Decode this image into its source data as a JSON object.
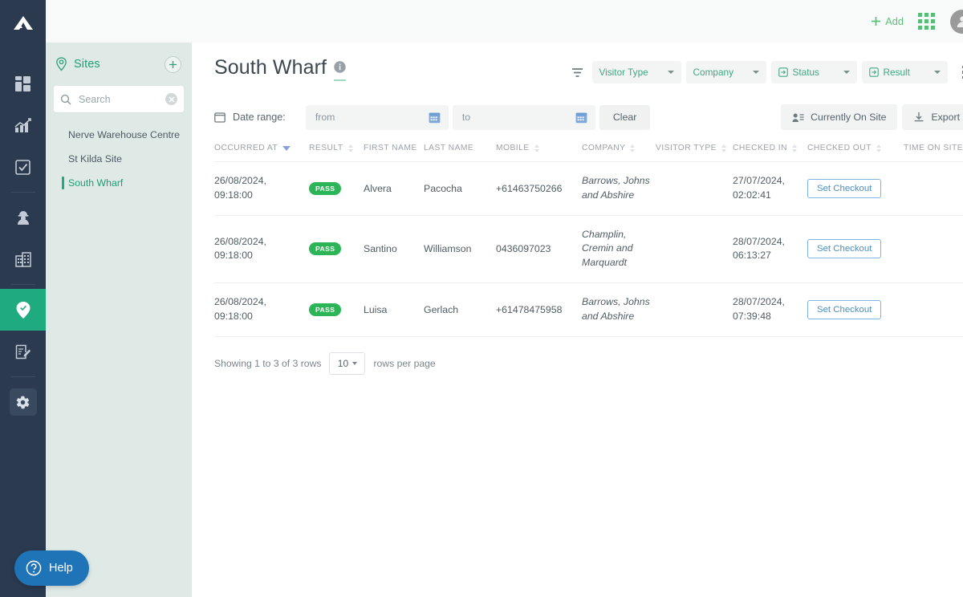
{
  "topbar": {
    "add_label": "Add",
    "add_icon": "plus-icon",
    "apps_icon": "apps-grid-icon",
    "avatar_icon": "user-avatar-icon"
  },
  "rail": {
    "logo_icon": "mountain-logo-icon",
    "items": [
      {
        "icon": "dashboard-grid-icon",
        "name": "dashboard",
        "active": false
      },
      {
        "icon": "bar-chart-icon",
        "name": "analytics",
        "active": false
      },
      {
        "icon": "checklist-icon",
        "name": "tasks",
        "active": false
      },
      {
        "icon": "worker-icon",
        "name": "workers",
        "active": false
      },
      {
        "icon": "building-icon",
        "name": "companies",
        "active": false
      },
      {
        "icon": "location-pin-check-icon",
        "name": "sites",
        "active": true
      },
      {
        "icon": "clipboard-edit-icon",
        "name": "forms",
        "active": false
      },
      {
        "icon": "gear-icon",
        "name": "settings",
        "active": false
      }
    ]
  },
  "sites_panel": {
    "pin_icon": "location-pin-icon",
    "title": "Sites",
    "add_icon": "plus-icon",
    "search": {
      "icon": "search-icon",
      "value": "",
      "placeholder": "Search",
      "clear_icon": "clear-circle-icon"
    },
    "items": [
      {
        "label": "Nerve Warehouse Centre",
        "active": false
      },
      {
        "label": "St Kilda Site",
        "active": false
      },
      {
        "label": "South Wharf",
        "active": true
      }
    ]
  },
  "page": {
    "title": "South Wharf",
    "info_icon": "info-icon"
  },
  "filters": {
    "funnel_icon": "filter-funnel-icon",
    "pills": [
      {
        "label": "Visitor Type",
        "icon": null
      },
      {
        "label": "Company",
        "icon": null
      },
      {
        "label": "Status",
        "icon": "login-box-icon"
      },
      {
        "label": "Result",
        "icon": "login-box-icon"
      }
    ],
    "kebab_icon": "more-vertical-icon"
  },
  "daterange": {
    "calendar_icon": "calendar-outline-icon",
    "label": "Date range:",
    "from": {
      "value": "",
      "placeholder": "from",
      "icon": "calendar-icon"
    },
    "to": {
      "value": "",
      "placeholder": "to",
      "icon": "calendar-icon"
    },
    "clear_label": "Clear"
  },
  "actions": {
    "currently_on_site": {
      "label": "Currently On Site",
      "icon": "people-list-icon"
    },
    "export": {
      "label": "Export",
      "icon": "download-icon"
    }
  },
  "table": {
    "columns": [
      {
        "label": "Occurred At",
        "sort": "desc"
      },
      {
        "label": "Result",
        "sort": "both"
      },
      {
        "label": "First Name",
        "sort": "none"
      },
      {
        "label": "Last Name",
        "sort": "none"
      },
      {
        "label": "Mobile",
        "sort": "both"
      },
      {
        "label": "Company",
        "sort": "both"
      },
      {
        "label": "Visitor Type",
        "sort": "both"
      },
      {
        "label": "Checked In",
        "sort": "both"
      },
      {
        "label": "Checked Out",
        "sort": "both"
      },
      {
        "label": "Time On Site",
        "sort": "none"
      }
    ],
    "rows": [
      {
        "occurred_at": "26/08/2024, 09:18:00",
        "result": "PASS",
        "first_name": "Alvera",
        "last_name": "Pacocha",
        "mobile": "+61463750266",
        "company": "Barrows, Johns and Abshire",
        "visitor_type": "",
        "checked_in": "27/07/2024, 02:02:41",
        "checked_out_action": "Set Checkout",
        "time_on_site": ""
      },
      {
        "occurred_at": "26/08/2024, 09:18:00",
        "result": "PASS",
        "first_name": "Santino",
        "last_name": "Williamson",
        "mobile": "0436097023",
        "company": "Champlin, Cremin and Marquardt",
        "visitor_type": "",
        "checked_in": "28/07/2024, 06:13:27",
        "checked_out_action": "Set Checkout",
        "time_on_site": ""
      },
      {
        "occurred_at": "26/08/2024, 09:18:00",
        "result": "PASS",
        "first_name": "Luisa",
        "last_name": "Gerlach",
        "mobile": "+61478475958",
        "company": "Barrows, Johns and Abshire",
        "visitor_type": "",
        "checked_in": "28/07/2024, 07:39:48",
        "checked_out_action": "Set Checkout",
        "time_on_site": ""
      }
    ]
  },
  "pager": {
    "showing": "Showing 1 to 3 of 3 rows",
    "rows_per_page_value": "10",
    "rows_per_page_label": "rows per page"
  },
  "help": {
    "label": "Help",
    "icon": "question-circle-icon"
  },
  "colors": {
    "rail_bg": "#2b3a4f",
    "accent_green": "#1fab7f",
    "panel_bg": "#dfeae6",
    "pass_green": "#2cb557",
    "link_blue": "#4a8ec4",
    "help_blue": "#1f73b7"
  }
}
